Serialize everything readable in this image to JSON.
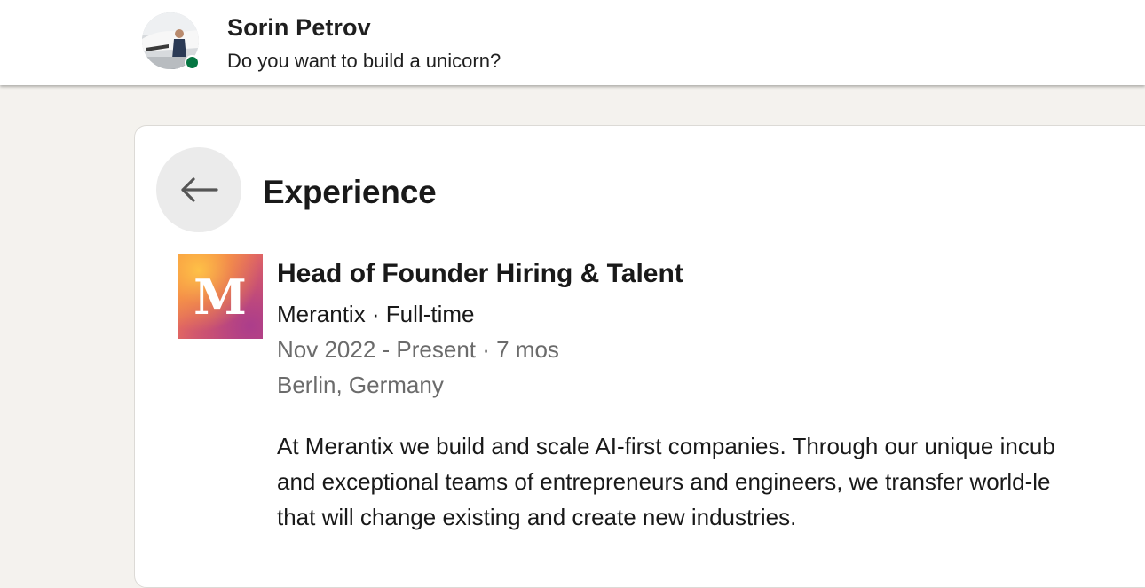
{
  "header": {
    "name": "Sorin Petrov",
    "headline": "Do you want to build a unicorn?",
    "presence_color": "#057642"
  },
  "section": {
    "title": "Experience",
    "back_icon": "arrow-left-icon"
  },
  "experience": {
    "logo_letter": "M",
    "title": "Head of Founder Hiring & Talent",
    "company_line": "Merantix · Full-time",
    "dates": "Nov 2022 - Present · 7 mos",
    "location": "Berlin, Germany",
    "description_lines": [
      "At Merantix we build and scale AI-first companies. Through our unique incub",
      "and exceptional teams of entrepreneurs and engineers, we transfer world-le",
      "that will change existing and create new industries."
    ]
  }
}
